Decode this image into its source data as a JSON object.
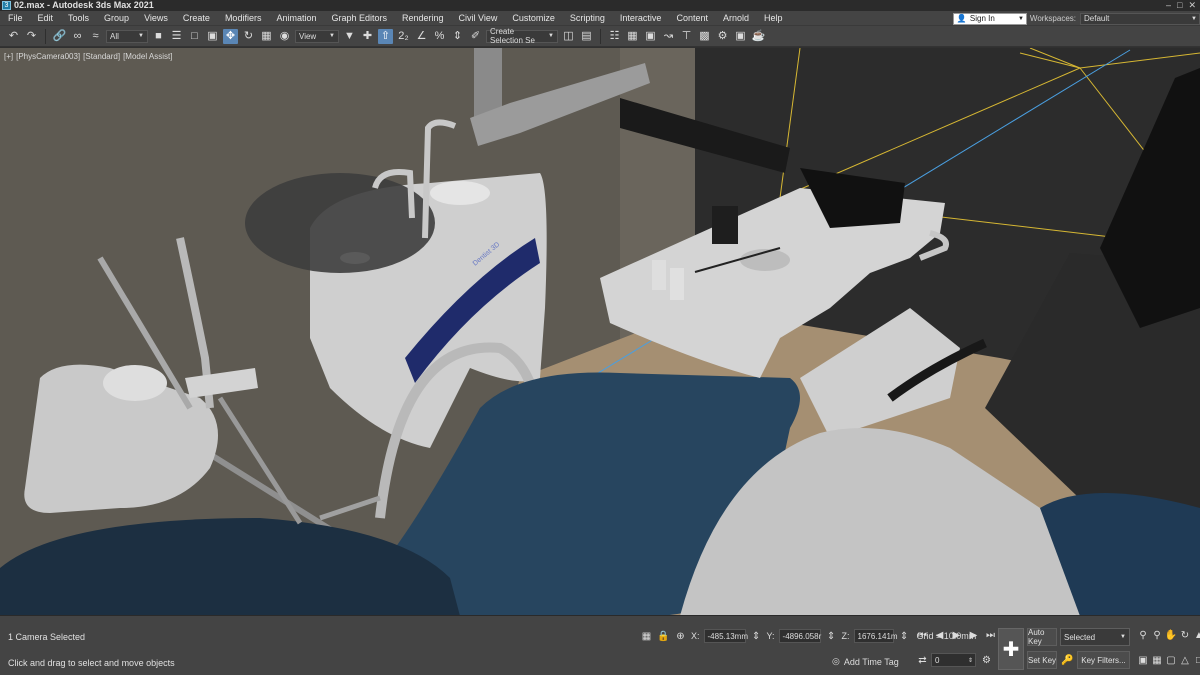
{
  "window": {
    "title": "02.max - Autodesk 3ds Max 2021",
    "app_icon": "3"
  },
  "menu": {
    "items": [
      "File",
      "Edit",
      "Tools",
      "Group",
      "Views",
      "Create",
      "Modifiers",
      "Animation",
      "Graph Editors",
      "Rendering",
      "Civil View",
      "Customize",
      "Scripting",
      "Interactive",
      "Content",
      "Arnold",
      "Help"
    ],
    "signin_label": "Sign In",
    "workspaces_label": "Workspaces:",
    "workspace_value": "Default"
  },
  "toolbar": {
    "filter_value": "All",
    "reference_coord_value": "View",
    "selection_set_value": "Create Selection Se"
  },
  "viewport": {
    "label_parts": [
      "[+]",
      "[PhysCamera003]",
      "[Standard]",
      "[Model Assist]"
    ],
    "monitor_label": "Dentist 3D"
  },
  "status": {
    "selection_text": "1 Camera Selected",
    "prompt_text": "Click and drag to select and move objects",
    "x_label": "X:",
    "x_value": "-485.13mm",
    "y_label": "Y:",
    "y_value": "-4896.058r",
    "z_label": "Z:",
    "z_value": "1676.141m",
    "grid_text": "Grid = 10.0mm",
    "time_tag_label": "Add Time Tag",
    "frame_value": "0",
    "auto_key_label": "Auto Key",
    "set_key_label": "Set Key",
    "key_mode_value": "Selected",
    "key_filters_label": "Key Filters..."
  },
  "colors": {
    "accent_active": "#5a86b5",
    "chrome_bg": "#444444",
    "title_bg": "#2b2b2b",
    "chair_blue": "#27455f",
    "selection_line": "#4a9fe0",
    "camera_frustum": "#d6b733"
  }
}
